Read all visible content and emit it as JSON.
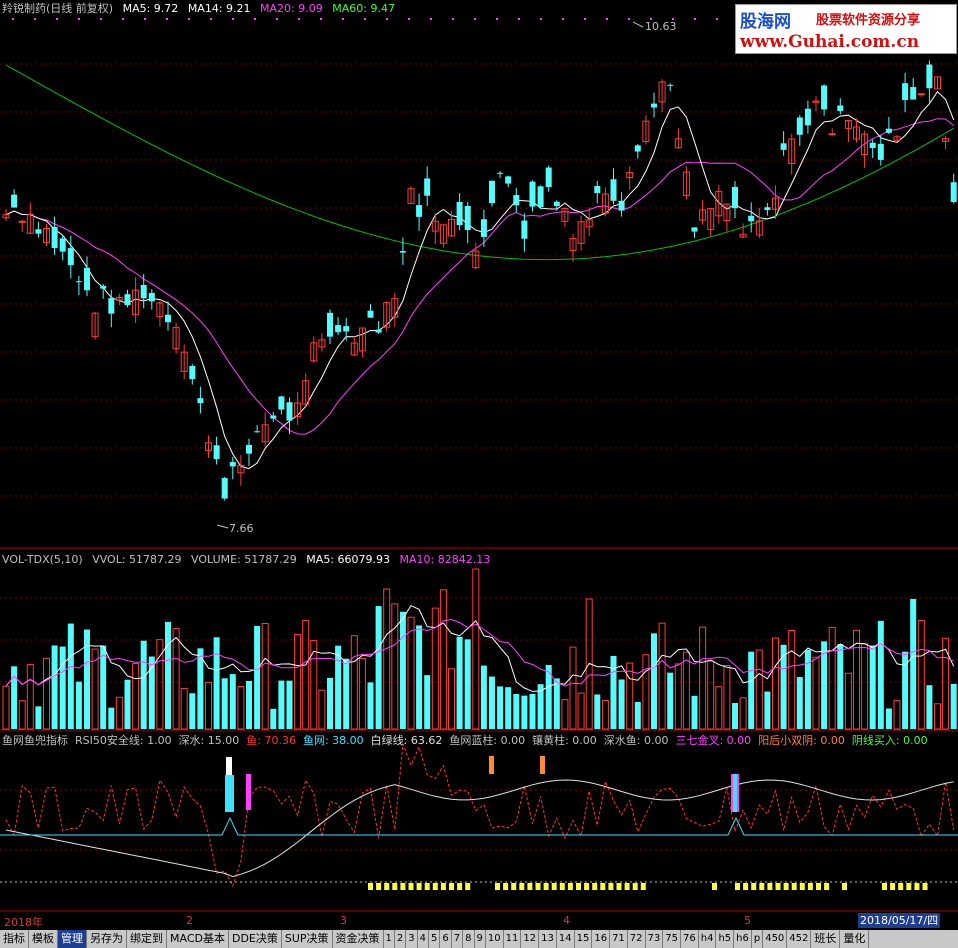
{
  "header": {
    "title": "羚锐制药(日线 前复权)",
    "ma5": "MA5: 9.72",
    "ma14": "MA14: 9.21",
    "ma20": "MA20: 9.09",
    "ma60": "MA60: 9.47"
  },
  "price_labels": {
    "high": "10.63",
    "low": "7.66"
  },
  "logo": {
    "line1": "股海网",
    "line2": "股票软件资源分享",
    "line3": "www.Guhai.com.cn"
  },
  "volume_header": {
    "name": "VOL-TDX(5,10)",
    "vvol": "VVOL: 51787.29",
    "volume": "VOLUME: 51787.29",
    "ma5": "MA5: 66079.93",
    "ma10": "MA10: 82842.13"
  },
  "indicator_header": [
    {
      "text": "鱼网鱼兜指标",
      "color": "#c0c0c0"
    },
    {
      "text": "RSI50安全线: 1.00",
      "color": "#c0c0c0"
    },
    {
      "text": "深水: 15.00",
      "color": "#c0c0c0"
    },
    {
      "text": "鱼: 70.36",
      "color": "#ff3333"
    },
    {
      "text": "鱼网: 38.00",
      "color": "#40e0ff"
    },
    {
      "text": "白绿线: 63.62",
      "color": "#e0e0e0"
    },
    {
      "text": "鱼网蓝柱: 0.00",
      "color": "#c0c0c0"
    },
    {
      "text": "镶黄柱: 0.00",
      "color": "#c0c0c0"
    },
    {
      "text": "深水鱼: 0.00",
      "color": "#c0c0c0"
    },
    {
      "text": "三七金叉: 0.00",
      "color": "#ff40ff"
    },
    {
      "text": "阳后小双阴: 0.00",
      "color": "#ff8040"
    },
    {
      "text": "阴线买入: 0.00",
      "color": "#40ff40"
    }
  ],
  "dates": {
    "labels": [
      {
        "text": "2018年"
      },
      {
        "text": "2"
      },
      {
        "text": "3"
      },
      {
        "text": "4"
      },
      {
        "text": "5"
      }
    ],
    "current": "2018/05/17/四"
  },
  "toolbar": [
    "指标",
    "模板",
    "管理",
    "另存为",
    "绑定到",
    "MACD基本",
    "DDE决策",
    "SUP决策",
    "资金决策",
    "1",
    "2",
    "3",
    "4",
    "5",
    "6",
    "7",
    "8",
    "9",
    "10",
    "11",
    "12",
    "13",
    "14",
    "15",
    "16",
    "71",
    "72",
    "73",
    "75",
    "76",
    "h4",
    "h5",
    "h6",
    "p",
    "450",
    "452",
    "班长",
    "量化"
  ],
  "colors": {
    "up": "#ff3c3c",
    "down": "#54fcfc",
    "ma5": "#ffffff",
    "ma14": "#ff40ff",
    "ma60": "#00c000",
    "grid": "#800000"
  }
}
